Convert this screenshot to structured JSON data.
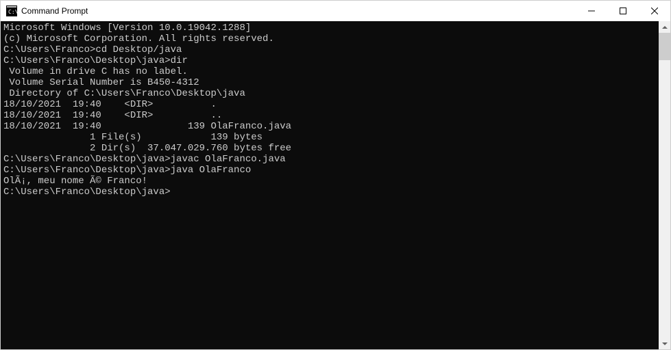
{
  "window": {
    "title": "Command Prompt"
  },
  "terminal": {
    "lines": [
      "Microsoft Windows [Version 10.0.19042.1288]",
      "(c) Microsoft Corporation. All rights reserved.",
      "",
      "C:\\Users\\Franco>cd Desktop/java",
      "",
      "C:\\Users\\Franco\\Desktop\\java>dir",
      " Volume in drive C has no label.",
      " Volume Serial Number is B450-4312",
      "",
      " Directory of C:\\Users\\Franco\\Desktop\\java",
      "",
      "18/10/2021  19:40    <DIR>          .",
      "18/10/2021  19:40    <DIR>          ..",
      "18/10/2021  19:40               139 OlaFranco.java",
      "               1 File(s)            139 bytes",
      "               2 Dir(s)  37.047.029.760 bytes free",
      "",
      "C:\\Users\\Franco\\Desktop\\java>javac OlaFranco.java",
      "",
      "C:\\Users\\Franco\\Desktop\\java>java OlaFranco",
      "OlÃ¡, meu nome Ã© Franco!",
      "",
      "C:\\Users\\Franco\\Desktop\\java>"
    ]
  }
}
